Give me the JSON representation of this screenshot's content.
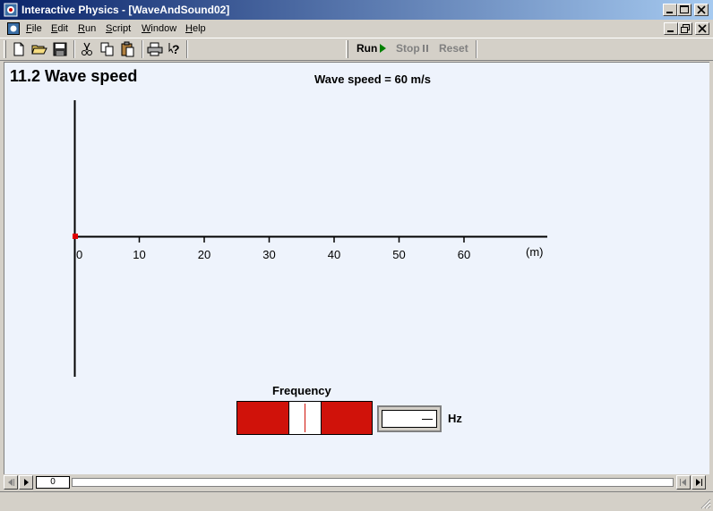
{
  "window": {
    "title": "Interactive Physics - [WaveAndSound02]"
  },
  "menu": [
    {
      "label": "File",
      "mnemonic": "F",
      "rest": "ile"
    },
    {
      "label": "Edit",
      "mnemonic": "E",
      "rest": "dit"
    },
    {
      "label": "Run",
      "mnemonic": "R",
      "rest": "un"
    },
    {
      "label": "Script",
      "mnemonic": "S",
      "rest": "cript"
    },
    {
      "label": "Window",
      "mnemonic": "W",
      "rest": "indow"
    },
    {
      "label": "Help",
      "mnemonic": "H",
      "rest": "elp"
    }
  ],
  "toolbar": {
    "icons": [
      "new-file-icon",
      "open-folder-icon",
      "save-icon",
      "cut-icon",
      "copy-icon",
      "paste-icon",
      "print-icon",
      "help-icon"
    ],
    "run_label": "Run",
    "stop_label": "Stop",
    "reset_label": "Reset"
  },
  "simulation": {
    "heading": "11.2 Wave speed",
    "speed_readout": "Wave speed = 60 m/s",
    "axis_ticks": [
      "0",
      "10",
      "20",
      "30",
      "40",
      "50",
      "60"
    ],
    "axis_unit": "(m)",
    "source_color": "#e00000",
    "frequency_title": "Frequency",
    "frequency_value": "",
    "frequency_unit": "Hz",
    "slider_color": "#d0120a"
  },
  "playback": {
    "frame": "0"
  }
}
